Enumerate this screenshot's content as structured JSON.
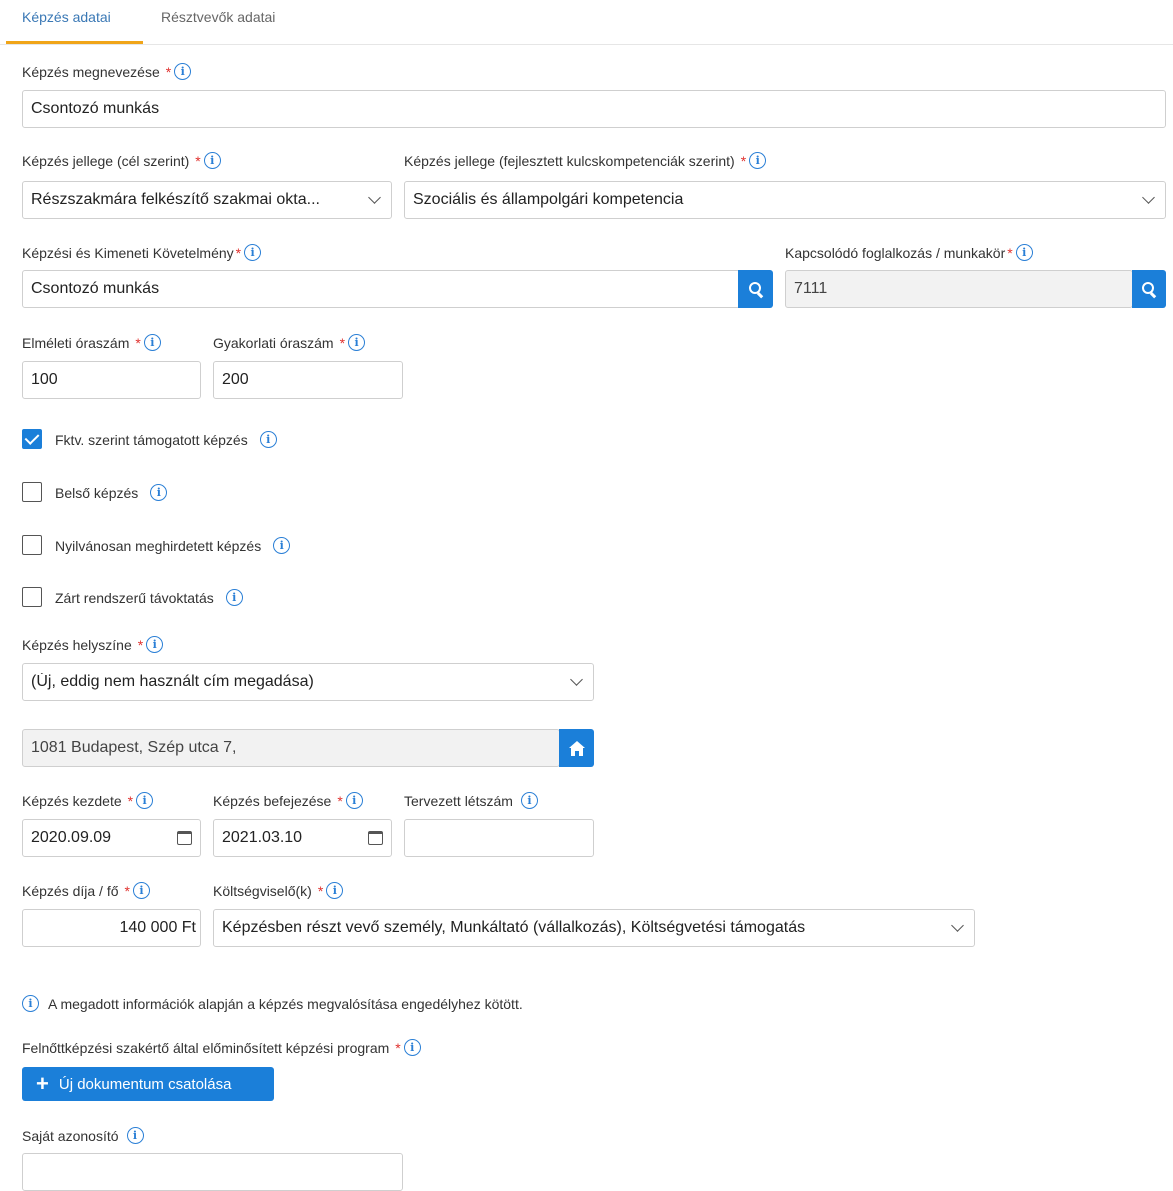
{
  "tabs": [
    "Képzés adatai",
    "Résztvevők adatai"
  ],
  "fields": {
    "name": {
      "label": "Képzés megnevezése",
      "value": "Csontozó munkás"
    },
    "type_goal": {
      "label": "Képzés jellege (cél szerint)",
      "value": "Részszakmára felkészítő szakmai okta..."
    },
    "type_competence": {
      "label": "Képzés jellege (fejlesztett kulcskompetenciák szerint)",
      "value": "Szociális és állampolgári kompetencia"
    },
    "kkk": {
      "label": "Képzési és Kimeneti Követelmény",
      "value": "Csontozó munkás"
    },
    "occupation": {
      "label": "Kapcsolódó foglalkozás / munkakör",
      "value": "7111"
    },
    "theory_hours": {
      "label": "Elméleti óraszám",
      "value": "100"
    },
    "practice_hours": {
      "label": "Gyakorlati óraszám",
      "value": "200"
    },
    "location": {
      "label": "Képzés helyszíne",
      "value": "(Új, eddig nem használt cím megadása)"
    },
    "address": {
      "value": "1081 Budapest, Szép utca 7,"
    },
    "start": {
      "label": "Képzés kezdete",
      "value": "2020.09.09"
    },
    "end": {
      "label": "Képzés befejezése",
      "value": "2021.03.10"
    },
    "headcount": {
      "label": "Tervezett létszám",
      "value": ""
    },
    "fee": {
      "label": "Képzés díja / fő",
      "value": "140 000 Ft"
    },
    "payer": {
      "label": "Költségviselő(k)",
      "value": "Képzésben részt vevő személy, Munkáltató (vállalkozás), Költségvetési támogatás"
    },
    "program": {
      "label": "Felnőttképzési szakértő által előminősített képzési program"
    },
    "own_id": {
      "label": "Saját azonosító",
      "value": ""
    }
  },
  "checkboxes": [
    {
      "label": "Fktv. szerint támogatott képzés",
      "checked": true
    },
    {
      "label": "Belső képzés",
      "checked": false
    },
    {
      "label": "Nyilvánosan meghirdetett képzés",
      "checked": false
    },
    {
      "label": "Zárt rendszerű távoktatás",
      "checked": false
    }
  ],
  "notice": "A megadott információk alapján a képzés megvalósítása engedélyhez kötött.",
  "required_mark": "*",
  "info_glyph": "i",
  "attach_button": {
    "icon": "+",
    "label": "Új dokumentum csatolása"
  },
  "colors": {
    "accent": "#1b7fd9",
    "tab_underline": "#f0a519",
    "required": "#e0312e"
  }
}
